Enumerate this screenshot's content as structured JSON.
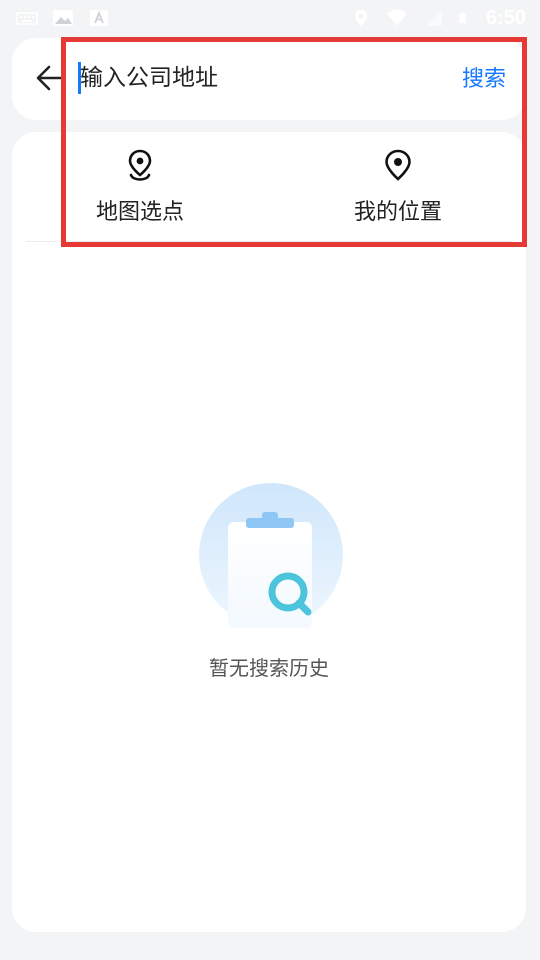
{
  "status_bar": {
    "time": "6:50",
    "left_icons": [
      "keyboard-icon",
      "image-icon",
      "text-icon"
    ],
    "right_icons": [
      "location-icon",
      "wifi-icon",
      "signal-icon",
      "battery-icon"
    ]
  },
  "search": {
    "placeholder": "输入公司地址",
    "value": "",
    "button_label": "搜索",
    "back_icon": "arrow-left-icon"
  },
  "quick_actions": [
    {
      "label": "地图选点",
      "icon": "map-pin-icon"
    },
    {
      "label": "我的位置",
      "icon": "my-location-icon"
    }
  ],
  "empty_state": {
    "text": "暂无搜索历史",
    "icon": "clipboard-search-icon"
  },
  "colors": {
    "accent": "#1677ff",
    "background": "#f3f4f6",
    "card": "#ffffff",
    "highlight": "#e53935"
  }
}
